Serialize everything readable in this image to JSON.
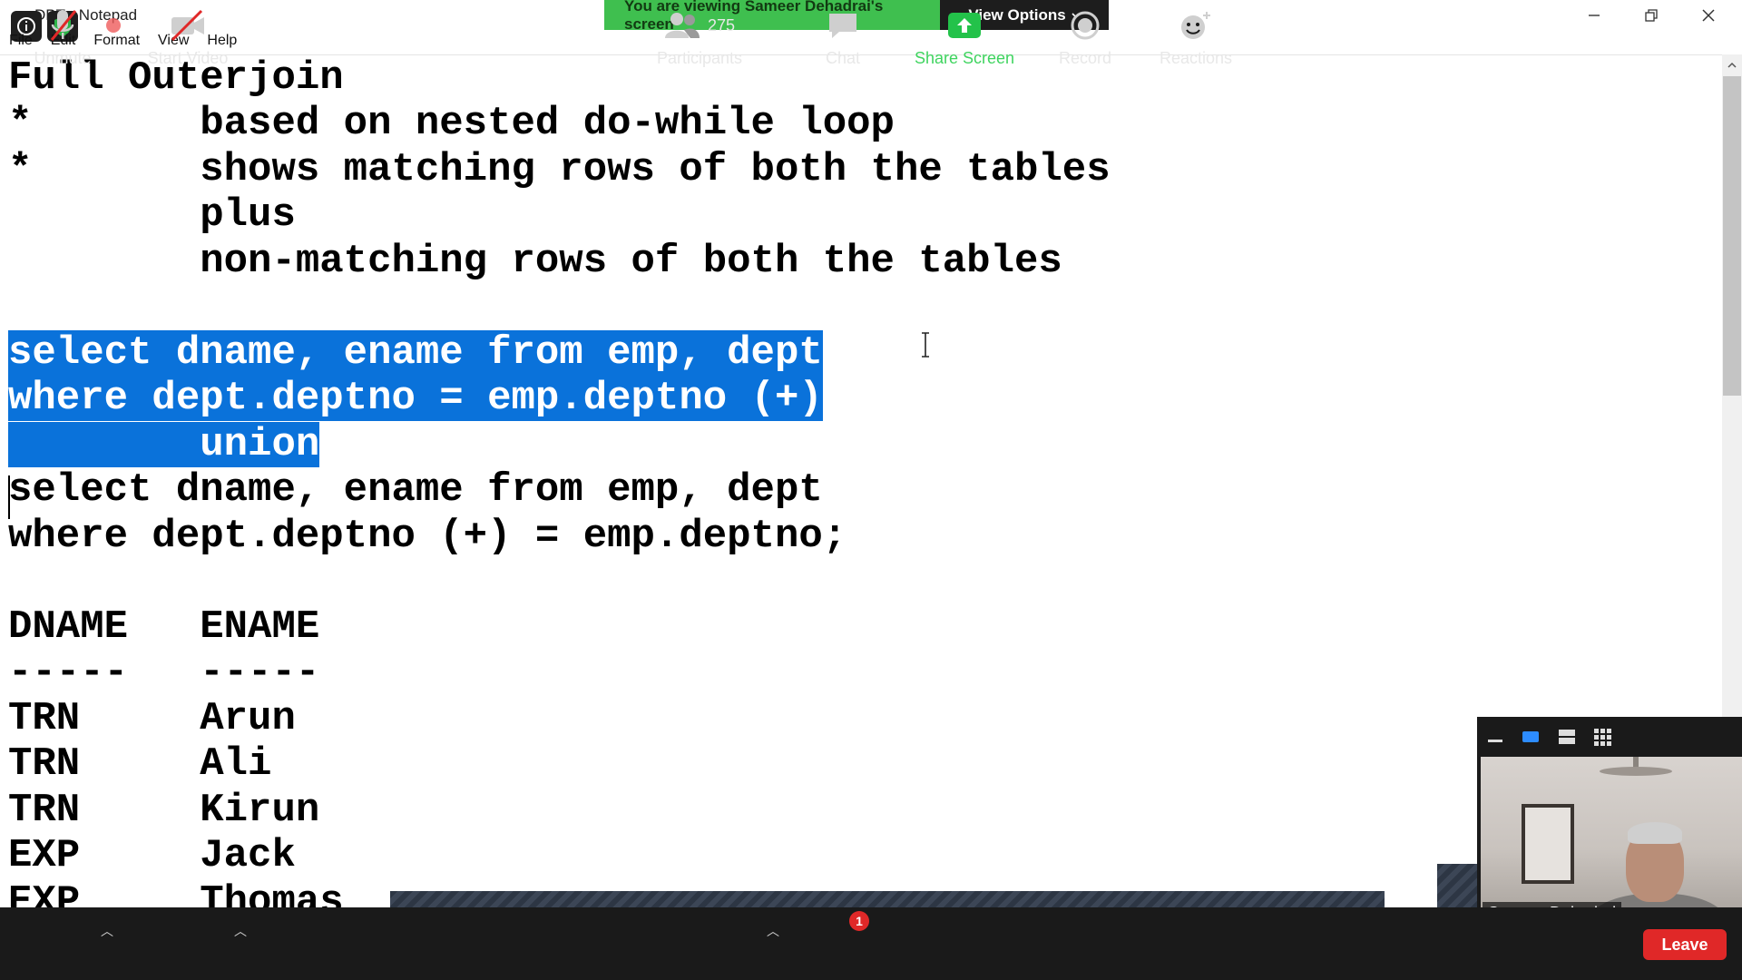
{
  "window": {
    "title": "DBT - Notepad"
  },
  "share_banner": {
    "message": "You are viewing Sameer Dehadrai's screen",
    "view_options": "View Options"
  },
  "menu": [
    "File",
    "Edit",
    "Format",
    "View",
    "Help"
  ],
  "editor": {
    "lines": [
      "Full Outerjoin",
      "*       based on nested do-while loop",
      "*       shows matching rows of both the tables",
      "        plus",
      "        non-matching rows of both the tables",
      "",
      "select dname, ename from emp, dept",
      "where dept.deptno = emp.deptno (+)",
      "        union",
      "select dname, ename from emp, dept",
      "where dept.deptno (+) = emp.deptno;",
      "",
      "DNAME   ENAME",
      "-----   -----",
      "TRN     Arun",
      "TRN     Ali",
      "TRN     Kirun",
      "EXP     Jack",
      "EXP     Thomas"
    ],
    "selected_lines": [
      6,
      7,
      8
    ]
  },
  "video": {
    "participant_name": "Sameer Dehadrai"
  },
  "toolbar": {
    "unmute": "Unmute",
    "start_video": "Start Video",
    "participants": "Participants",
    "participant_count": "275",
    "chat": "Chat",
    "chat_badge": "1",
    "share_screen": "Share Screen",
    "record": "Record",
    "reactions": "Reactions",
    "leave": "Leave"
  },
  "colors": {
    "share_green": "#3fbf4f",
    "selection_blue": "#0a72da",
    "leave_red": "#e02828",
    "toolbar_bg": "#1a1a1a"
  }
}
